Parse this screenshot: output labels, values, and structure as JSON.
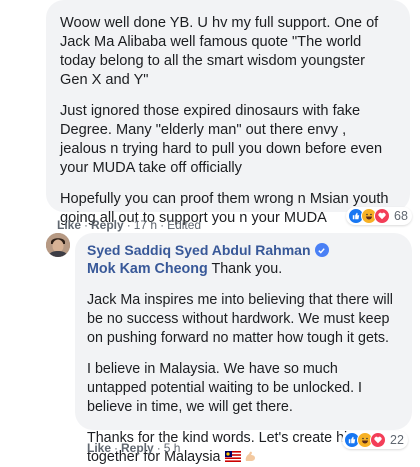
{
  "comment1": {
    "paragraphs": [
      "Woow well done YB. U hv my full support. One of Jack Ma Alibaba well famous quote \"The world today belong to all the smart wisdom youngster Gen X and Y\"",
      "Just ignored those expired dinosaurs with fake Degree. Many \"elderly man\" out there envy , jealous n trying hard to pull you down before even your MUDA take off officially",
      "Hopefully you can proof them wrong n Msian youth going all out to support you n your MUDA"
    ],
    "actions": {
      "like": "Like",
      "sep1": "·",
      "reply": "Reply",
      "sep2": "·",
      "time": "17 h",
      "sep3": "·",
      "edited": "Edited"
    },
    "reactions": {
      "icons": [
        "like-icon",
        "haha-icon",
        "love-icon"
      ],
      "count": "68"
    }
  },
  "reply": {
    "author": "Syed Saddiq Syed Abdul Rahman",
    "mention": "Mok Kam Cheong",
    "first_line": " Thank you.",
    "paragraphs": [
      "Jack Ma inspires me into believing that there will be no success without hardwork. We must keep on pushing forward no matter how tough it gets.",
      "I believe in Malaysia. We have so much untapped potential waiting to be unlocked. I believe in time, we will get there."
    ],
    "last_paragraph": "Thanks for the kind words. Let's create history together for Malaysia",
    "actions": {
      "like": "Like",
      "sep1": "·",
      "reply": "Reply",
      "sep2": "·",
      "time": "5 h"
    },
    "reactions": {
      "icons": [
        "like-icon",
        "haha-icon",
        "love-icon"
      ],
      "count": "22"
    }
  },
  "colors": {
    "bubble": "#f2f3f5",
    "author": "#385898",
    "like": "#1877f2",
    "haha": "#f7b125",
    "love": "#f33e58",
    "meta": "#606770"
  }
}
